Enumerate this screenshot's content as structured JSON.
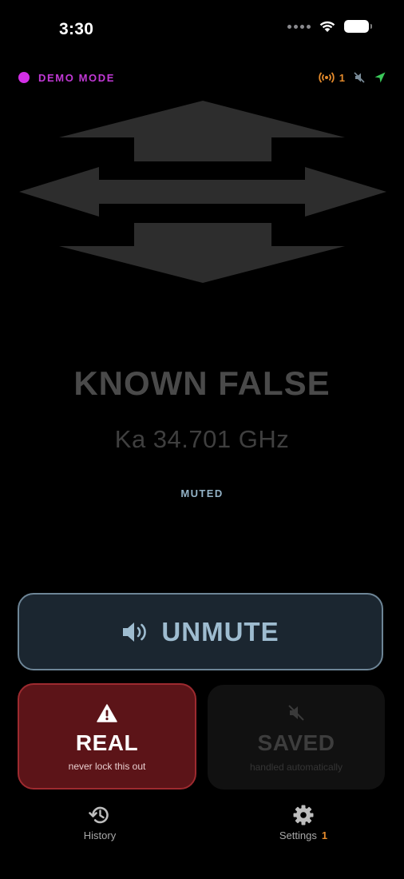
{
  "status_bar": {
    "time": "3:30"
  },
  "mode": {
    "label": "DEMO MODE",
    "dot_color": "#d22fe6",
    "antenna_count": "1",
    "icons": [
      "antenna-icon",
      "speaker-muted-icon",
      "location-arrow-icon"
    ]
  },
  "alert": {
    "graphic": "bidirectional-arrows-icon",
    "title": "KNOWN FALSE",
    "frequency": "Ka 34.701 GHz",
    "state": "MUTED"
  },
  "actions": {
    "unmute_label": "UNMUTE",
    "real_label": "REAL",
    "real_sub": "never lock this out",
    "saved_label": "SAVED",
    "saved_sub": "handled automatically"
  },
  "tabs": {
    "history_label": "History",
    "settings_label": "Settings",
    "settings_badge": "1"
  },
  "colors": {
    "accent_purple": "#c239d6",
    "accent_orange": "#e58b2c",
    "accent_green": "#3bc95a",
    "real_red": "#5c1418",
    "unmute_blue": "#9ebcd0"
  }
}
